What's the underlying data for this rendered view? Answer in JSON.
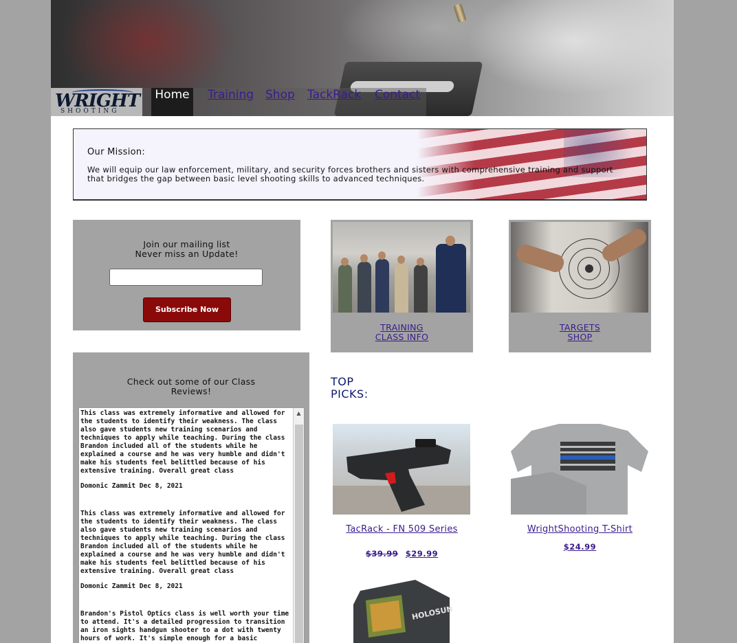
{
  "header": {
    "logo_word": "WRIGHT",
    "logo_sub": "SHOOTING",
    "nav": [
      {
        "label": "Home"
      },
      {
        "label": "Training"
      },
      {
        "label": "Shop"
      },
      {
        "label": "TackRack"
      },
      {
        "label": "Contact"
      }
    ]
  },
  "mission": {
    "title": "Our Mission:",
    "text": "We will equip our law enforcement, military, and security forces brothers and sisters with comprehensive training and support that bridges the gap between basic level shooting skills to advanced techniques."
  },
  "mailing": {
    "title_line1": "Join our mailing list",
    "title_line2": "Never miss an Update!",
    "email_value": "",
    "subscribe_label": "Subscribe Now"
  },
  "promos": {
    "training_line1": "TRAINING",
    "training_line2": "CLASS INFO",
    "targets_line1": "TARGETS",
    "targets_line2": "SHOP"
  },
  "reviews": {
    "title_line1": "Check out some of our Class",
    "title_line2": "Reviews!",
    "items": [
      {
        "text": "This class was extremely informative and allowed for the students to identify their weakness. The class also gave students new training scenarios and techniques to apply while teaching. During the class Brandon included all of the students while he explained a course and he was very humble and didn't make his students feel belittled because of his extensive training. Overall great class",
        "author": "Domonic Zammit Dec 8, 2021"
      },
      {
        "text": "This class was extremely informative and allowed for the students to identify their weakness. The class also gave students new training scenarios and techniques to apply while teaching. During the class Brandon included all of the students while he explained a course and he was very humble and didn't make his students feel belittled because of his extensive training. Overall great class",
        "author": "Domonic Zammit Dec 8, 2021"
      },
      {
        "text": "Brandon's Pistol Optics class is well worth your time to attend. It's a detailed progression to transition an iron sights handgun shooter to a dot with twenty hours of work. It's simple enough for a basic shooter, but will challenge more advanced shooters to get faster and more accurate. His class will be very influential on our red dot handgun program.",
        "author": ""
      }
    ]
  },
  "top_picks": {
    "title_line1": "TOP",
    "title_line2": "PICKS:",
    "products": [
      {
        "name": "TacRack - FN 509 Series",
        "old_price": "$39.99",
        "price": "$29.99"
      },
      {
        "name": "WrightShooting T-Shirt",
        "price": "$24.99"
      },
      {
        "optic_brand": "HOLOSUN"
      }
    ]
  },
  "colors": {
    "link": "#3a1b8c",
    "panel_gray": "#a3a3a3",
    "subscribe_red": "#8a0a0a",
    "nav_active": "#1c1c1c"
  }
}
